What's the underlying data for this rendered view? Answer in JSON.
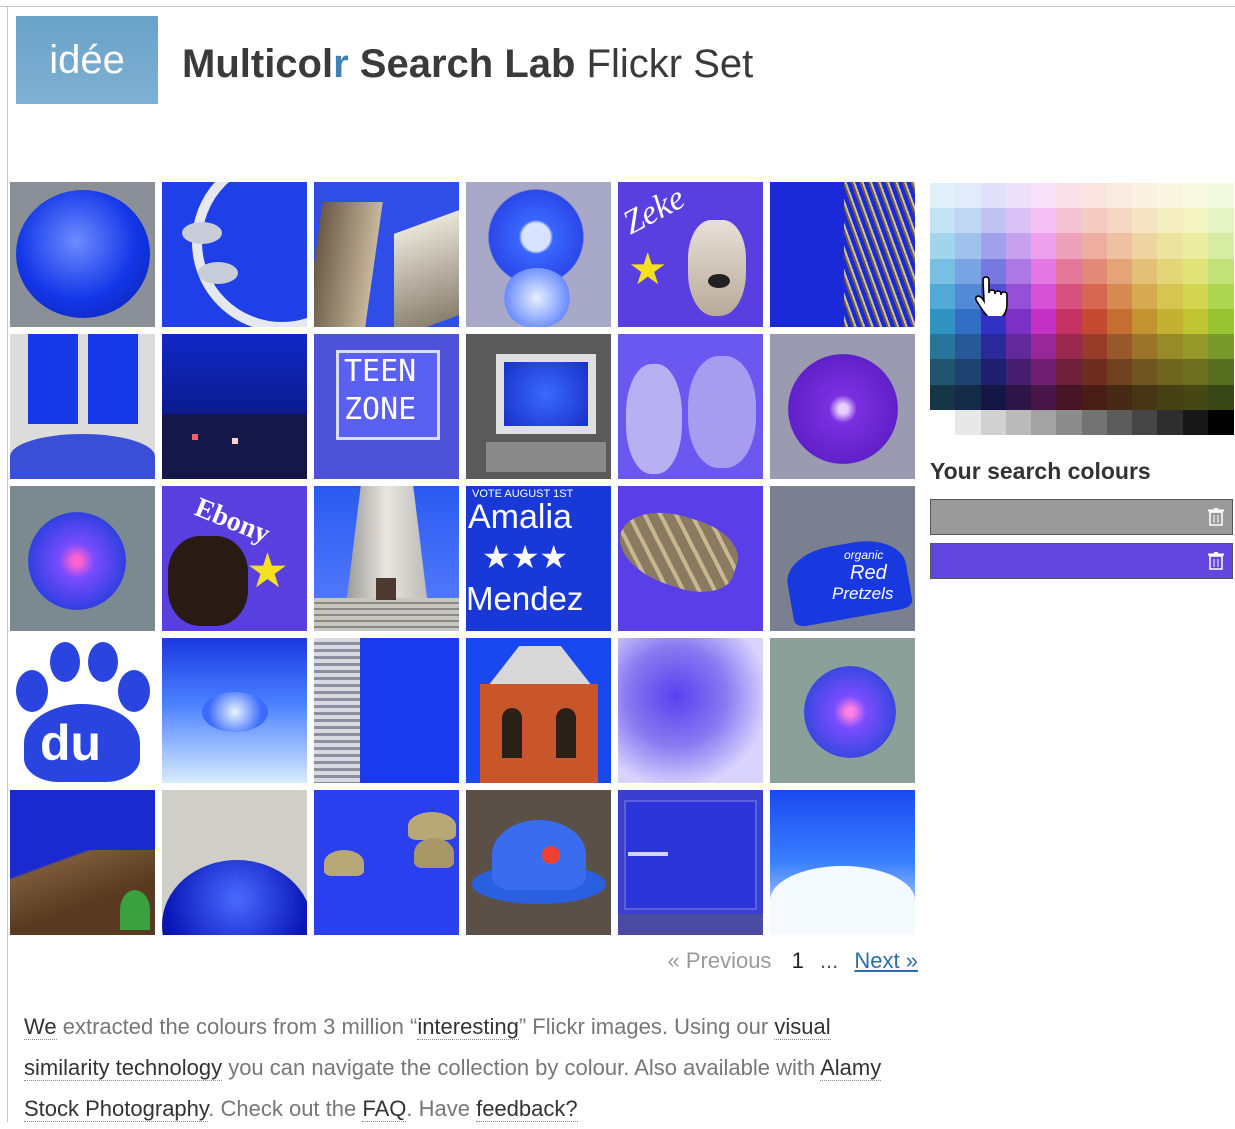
{
  "header": {
    "logo_text": "idée",
    "title_part1": "Multicol",
    "title_accent": "r",
    "title_part2": " Search Lab",
    "title_light": " Flickr Set"
  },
  "results": {
    "thumbnails": [
      {
        "label": ""
      },
      {
        "label": ""
      },
      {
        "label": ""
      },
      {
        "label": ""
      },
      {
        "label": "Zeke"
      },
      {
        "label": ""
      },
      {
        "label": ""
      },
      {
        "label": ""
      },
      {
        "label": "TEEN ZONE"
      },
      {
        "label": ""
      },
      {
        "label": ""
      },
      {
        "label": ""
      },
      {
        "label": ""
      },
      {
        "label": "Ebony"
      },
      {
        "label": ""
      },
      {
        "label": "Amalia Mendez"
      },
      {
        "label": ""
      },
      {
        "label": "Red Pretzels"
      },
      {
        "label": "du"
      },
      {
        "label": ""
      },
      {
        "label": ""
      },
      {
        "label": ""
      },
      {
        "label": ""
      },
      {
        "label": ""
      },
      {
        "label": ""
      },
      {
        "label": ""
      },
      {
        "label": ""
      },
      {
        "label": ""
      },
      {
        "label": ""
      },
      {
        "label": ""
      }
    ],
    "thumb_text": {
      "teen": "TEEN",
      "zone": "ZONE",
      "zeke": "Zeke",
      "ebony": "Ebony",
      "vote": "VOTE AUGUST 1ST",
      "amalia": "Amalia",
      "stars": "★★★",
      "mendez": "Mendez",
      "du": "du",
      "pretzels_1": "organic",
      "pretzels_2": "Red",
      "pretzels_3": "Pretzels"
    }
  },
  "pagination": {
    "previous": "« Previous",
    "current": "1",
    "ellipsis": "...",
    "next": "Next »"
  },
  "description": {
    "t1": "We",
    "t2": " extracted the colours from 3 million “",
    "t3": "interesting",
    "t4": "” Flickr images. Using our ",
    "t5": "visual similarity technology",
    "t6": " you can navigate the collection by colour. Also available with ",
    "t7": "Alamy Stock Photography",
    "t8": ". Check out the ",
    "t9": "FAQ",
    "t10": ". Have ",
    "t11": "feedback?"
  },
  "sidebar": {
    "search_colours_label": "Your search colours",
    "selected_colours": [
      "#9a9a9a",
      "#6147e0"
    ]
  },
  "colors": {
    "accent": "#3f82b8",
    "link": "#2d6ea8",
    "logo_bg": "#7fb0d2"
  }
}
